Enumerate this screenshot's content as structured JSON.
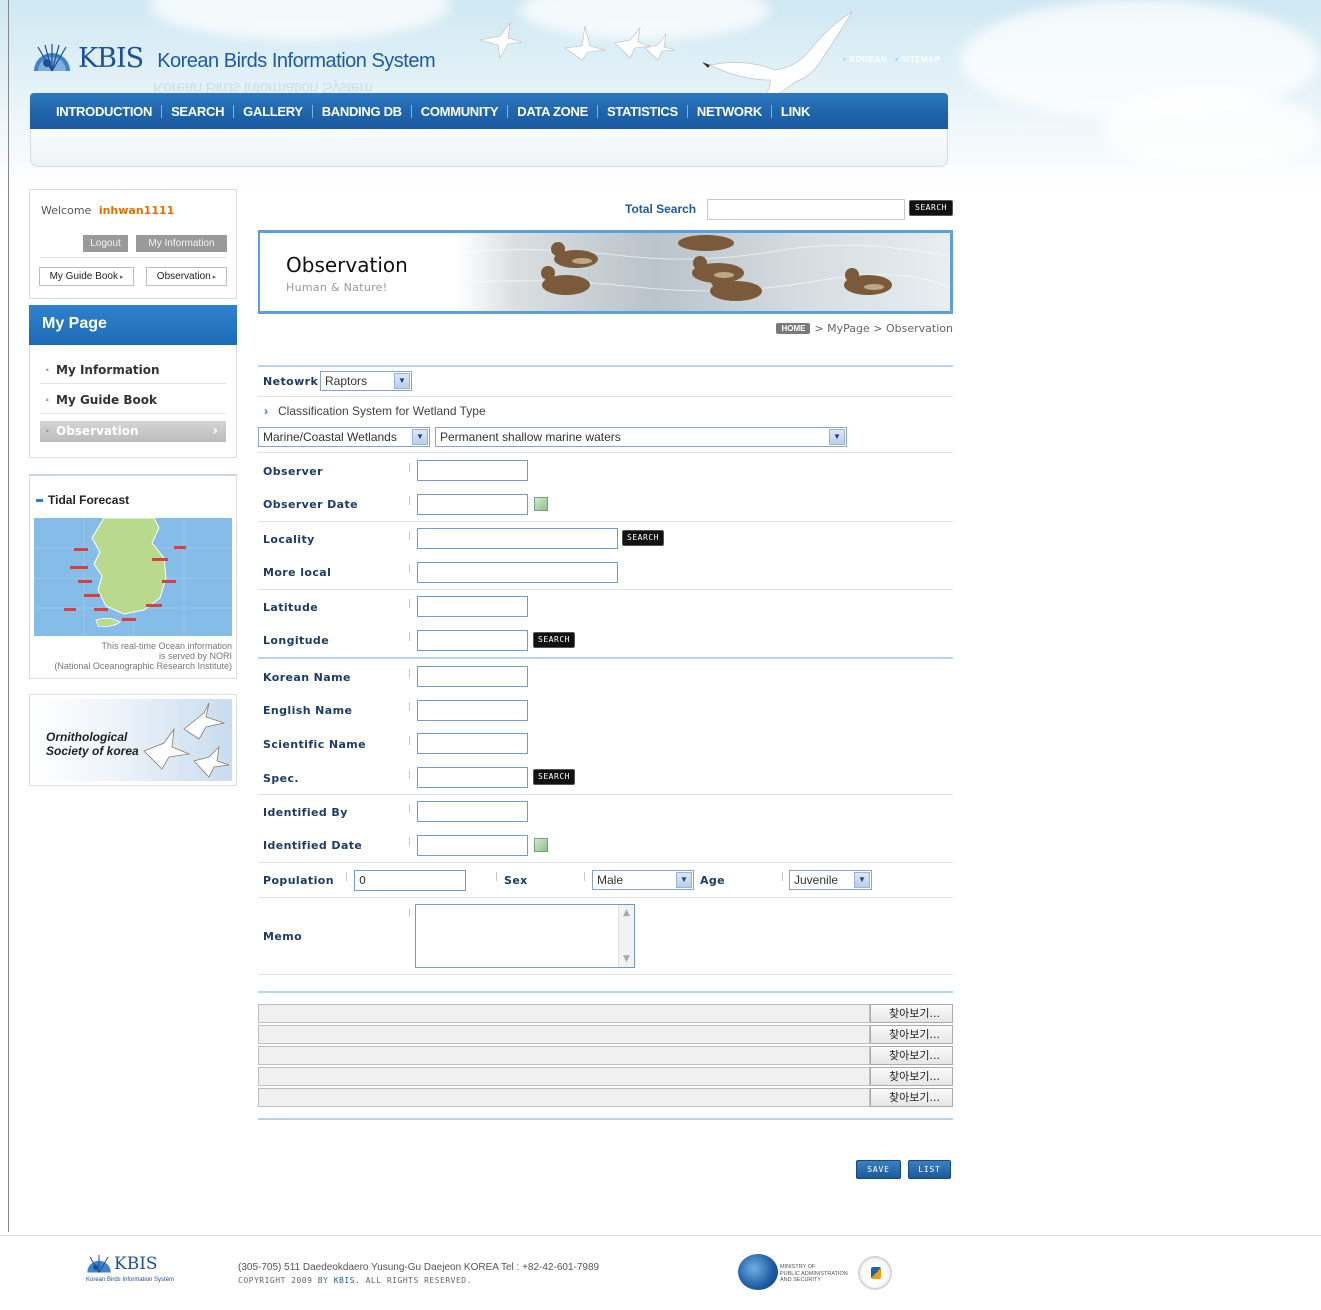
{
  "header": {
    "brand": "KBIS",
    "brand_full": "Korean Birds Information System",
    "top_links": [
      "KOREAN",
      "SITEMAP"
    ],
    "nav": [
      "INTRODUCTION",
      "SEARCH",
      "GALLERY",
      "BANDING DB",
      "COMMUNITY",
      "DATA ZONE",
      "STATISTICS",
      "NETWORK",
      "LINK"
    ]
  },
  "sidebar": {
    "welcome_prefix": "Welcome",
    "username": "inhwan1111",
    "logout": "Logout",
    "my_information_btn": "My Information",
    "guide_book_btn": "My Guide Book",
    "observation_btn": "Observation",
    "mypage_title": "My Page",
    "menu": [
      "My Information",
      "My Guide Book",
      "Observation"
    ],
    "tidal_title": "Tidal Forecast",
    "tidal_note": [
      "This real-time Ocean information",
      "is served by NORI",
      "(National Oceanographic Research Institute)"
    ],
    "orn_line1": "Ornithological",
    "orn_line2": "Society of korea"
  },
  "search": {
    "label": "Total Search",
    "value": "",
    "button": "SEARCH"
  },
  "banner": {
    "title": "Observation",
    "subtitle": "Human & Nature!"
  },
  "breadcrumb": {
    "home": "HOME",
    "path": "> MyPage > Observation"
  },
  "form": {
    "network_label": "Netowrk",
    "network_value": "Raptors",
    "classification_label": "Classification System for Wetland Type",
    "wetland_value": "Marine/Coastal Wetlands",
    "wetland_type_value": "Permanent shallow marine waters",
    "observer": "Observer",
    "observer_date": "Observer Date",
    "locality": "Locality",
    "more_local": "More local",
    "latitude": "Latitude",
    "longitude": "Longitude",
    "korean_name": "Korean Name",
    "english_name": "English Name",
    "scientific_name": "Scientific Name",
    "spec": "Spec.",
    "identified_by": "Identified By",
    "identified_date": "Identified Date",
    "population": "Population",
    "population_value": "0",
    "sex": "Sex",
    "sex_value": "Male",
    "age": "Age",
    "age_value": "Juvenile",
    "memo": "Memo",
    "search_btn": "SEARCH",
    "file_btn": "찾아보기...",
    "save_btn": "SAVE",
    "list_btn": "LIST"
  },
  "footer": {
    "brand": "KBIS",
    "brand_full": "Korean Birds Information System",
    "address": "(305-705) 511 Daedeokdaero Yusung-Gu Daejeon KOREA   Tel : +82-42-601-7989",
    "copyright_pre": "COPYRIGHT 2009 BY ",
    "copyright_brand": "KBIS",
    "copyright_post": ". ALL RIGHTS RESERVED.",
    "ministry": [
      "MINISTRY OF",
      "PUBLIC ADMINISTRATION",
      "AND SECURITY"
    ]
  },
  "colors": {
    "brand_blue": "#1e63aa",
    "accent_orange": "#e07000",
    "label_navy": "#1c3b66"
  }
}
